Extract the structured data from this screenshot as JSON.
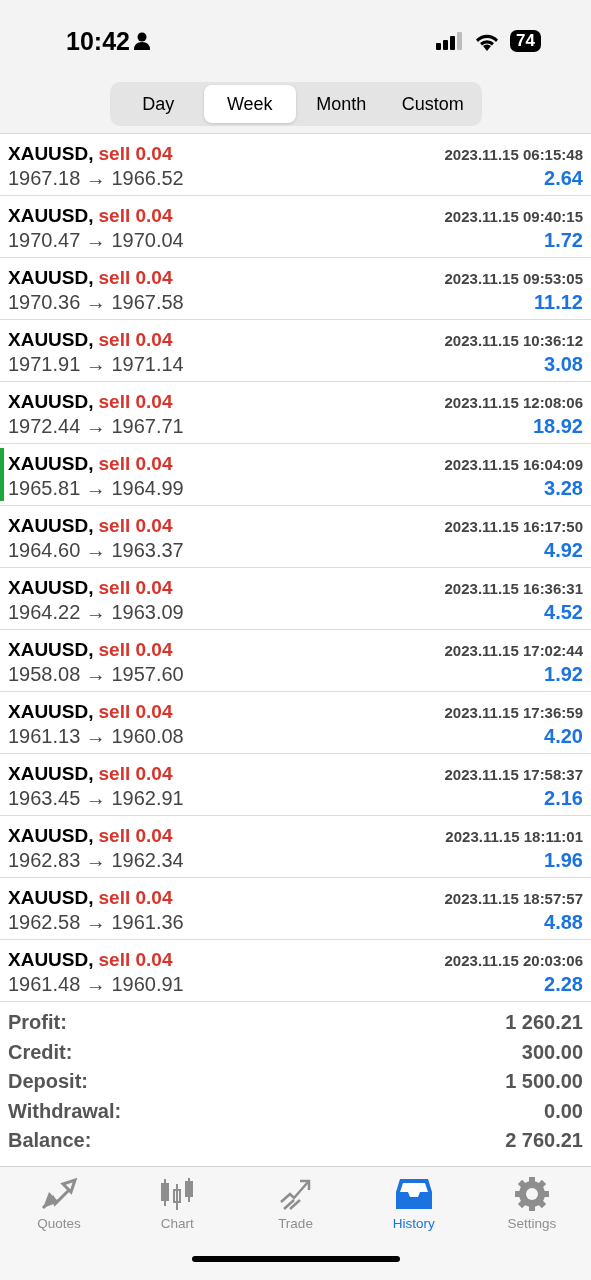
{
  "status_bar": {
    "time": "10:42",
    "battery": "74"
  },
  "period_tabs": [
    {
      "label": "Day",
      "selected": false
    },
    {
      "label": "Week",
      "selected": true
    },
    {
      "label": "Month",
      "selected": false
    },
    {
      "label": "Custom",
      "selected": false
    }
  ],
  "deals": [
    {
      "symbol": "XAUUSD,",
      "side": "sell 0.04",
      "time": "2023.11.15 06:15:48",
      "prices": "1967.18 → 1966.52",
      "profit": "2.64",
      "highlighted": false
    },
    {
      "symbol": "XAUUSD,",
      "side": "sell 0.04",
      "time": "2023.11.15 09:40:15",
      "prices": "1970.47 → 1970.04",
      "profit": "1.72",
      "highlighted": false
    },
    {
      "symbol": "XAUUSD,",
      "side": "sell 0.04",
      "time": "2023.11.15 09:53:05",
      "prices": "1970.36 → 1967.58",
      "profit": "11.12",
      "highlighted": false
    },
    {
      "symbol": "XAUUSD,",
      "side": "sell 0.04",
      "time": "2023.11.15 10:36:12",
      "prices": "1971.91 → 1971.14",
      "profit": "3.08",
      "highlighted": false
    },
    {
      "symbol": "XAUUSD,",
      "side": "sell 0.04",
      "time": "2023.11.15 12:08:06",
      "prices": "1972.44 → 1967.71",
      "profit": "18.92",
      "highlighted": false
    },
    {
      "symbol": "XAUUSD,",
      "side": "sell 0.04",
      "time": "2023.11.15 16:04:09",
      "prices": "1965.81 → 1964.99",
      "profit": "3.28",
      "highlighted": true
    },
    {
      "symbol": "XAUUSD,",
      "side": "sell 0.04",
      "time": "2023.11.15 16:17:50",
      "prices": "1964.60 → 1963.37",
      "profit": "4.92",
      "highlighted": false
    },
    {
      "symbol": "XAUUSD,",
      "side": "sell 0.04",
      "time": "2023.11.15 16:36:31",
      "prices": "1964.22 → 1963.09",
      "profit": "4.52",
      "highlighted": false
    },
    {
      "symbol": "XAUUSD,",
      "side": "sell 0.04",
      "time": "2023.11.15 17:02:44",
      "prices": "1958.08 → 1957.60",
      "profit": "1.92",
      "highlighted": false
    },
    {
      "symbol": "XAUUSD,",
      "side": "sell 0.04",
      "time": "2023.11.15 17:36:59",
      "prices": "1961.13 → 1960.08",
      "profit": "4.20",
      "highlighted": false
    },
    {
      "symbol": "XAUUSD,",
      "side": "sell 0.04",
      "time": "2023.11.15 17:58:37",
      "prices": "1963.45 → 1962.91",
      "profit": "2.16",
      "highlighted": false
    },
    {
      "symbol": "XAUUSD,",
      "side": "sell 0.04",
      "time": "2023.11.15 18:11:01",
      "prices": "1962.83 → 1962.34",
      "profit": "1.96",
      "highlighted": false
    },
    {
      "symbol": "XAUUSD,",
      "side": "sell 0.04",
      "time": "2023.11.15 18:57:57",
      "prices": "1962.58 → 1961.36",
      "profit": "4.88",
      "highlighted": false
    },
    {
      "symbol": "XAUUSD,",
      "side": "sell 0.04",
      "time": "2023.11.15 20:03:06",
      "prices": "1961.48 → 1960.91",
      "profit": "2.28",
      "highlighted": false
    }
  ],
  "summary": [
    {
      "label": "Profit:",
      "value": "1 260.21"
    },
    {
      "label": "Credit:",
      "value": "300.00"
    },
    {
      "label": "Deposit:",
      "value": "1 500.00"
    },
    {
      "label": "Withdrawal:",
      "value": "0.00"
    },
    {
      "label": "Balance:",
      "value": "2 760.21"
    }
  ],
  "bottom_tabs": [
    {
      "kind": "quotes",
      "label": "Quotes",
      "selected": false
    },
    {
      "kind": "chart",
      "label": "Chart",
      "selected": false
    },
    {
      "kind": "trade",
      "label": "Trade",
      "selected": false
    },
    {
      "kind": "history",
      "label": "History",
      "selected": true
    },
    {
      "kind": "settings",
      "label": "Settings",
      "selected": false
    }
  ]
}
